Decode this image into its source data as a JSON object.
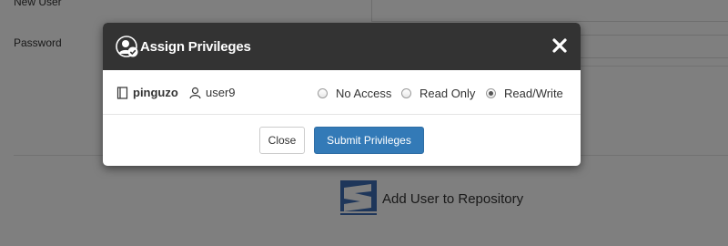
{
  "background": {
    "new_user_label": "New User",
    "password_label": "Password",
    "add_user_label": "Add User to Repository"
  },
  "modal": {
    "title": "Assign Privileges",
    "repository": "pinguzo",
    "user": "user9",
    "options": [
      {
        "label": "No Access",
        "checked": false
      },
      {
        "label": "Read Only",
        "checked": false
      },
      {
        "label": "Read/Write",
        "checked": true
      }
    ],
    "close_label": "Close",
    "submit_label": "Submit Privileges"
  },
  "colors": {
    "header_bg": "#333333",
    "primary": "#337ab7",
    "overlay": "rgba(0,0,0,0.5)"
  },
  "icons": {
    "header": "user-check-icon",
    "close": "close-icon",
    "repository": "book-icon",
    "user": "user-icon",
    "repo_logo": "subversion-logo-icon"
  }
}
